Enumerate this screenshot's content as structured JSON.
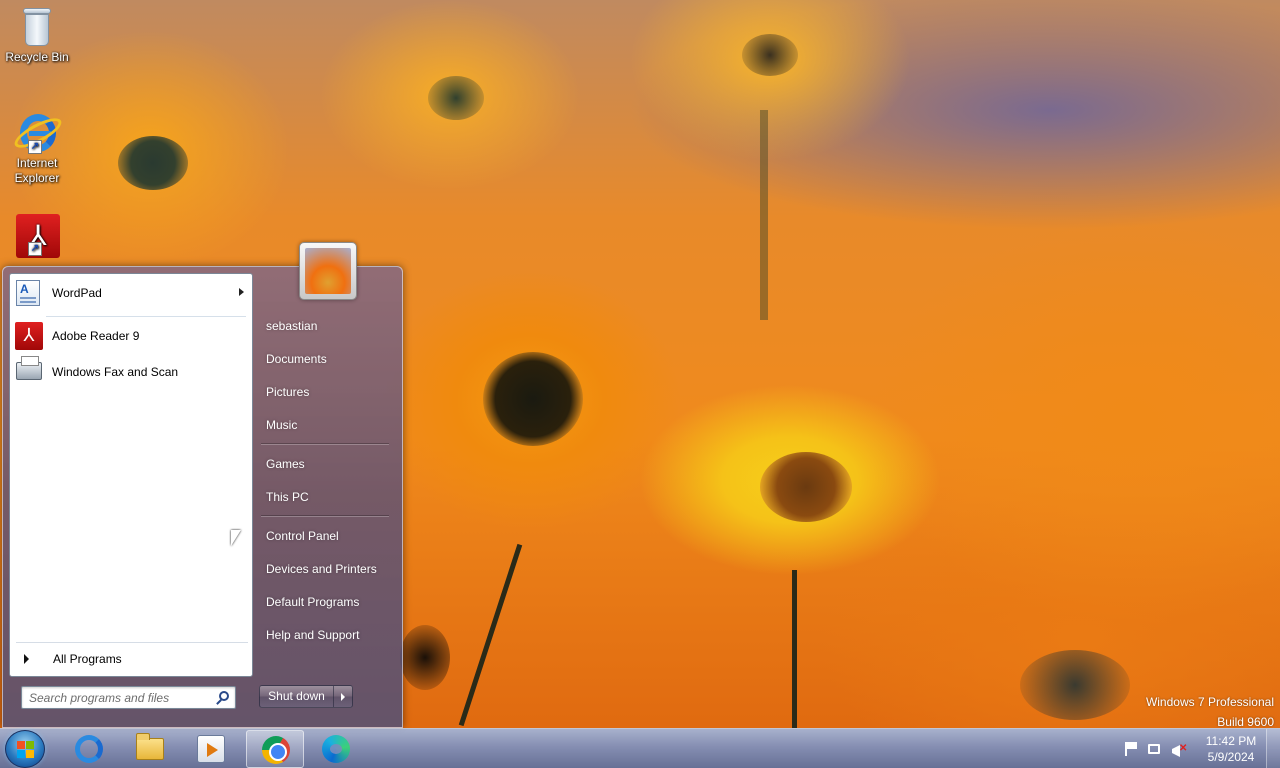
{
  "desktop": {
    "icons": [
      {
        "label": "Recycle Bin"
      },
      {
        "label": "Internet Explorer"
      },
      {
        "label": "Adobe Reader 9"
      }
    ],
    "watermark": {
      "line1": "Windows 7 Professional",
      "line2": "Build 9600"
    }
  },
  "start_menu": {
    "pinned": [
      {
        "label": "WordPad",
        "icon": "wordpad-icon",
        "has_submenu": true
      },
      {
        "label": "Adobe Reader 9",
        "icon": "adobe-reader-icon"
      },
      {
        "label": "Windows Fax and Scan",
        "icon": "fax-scanner-icon"
      }
    ],
    "all_programs": "All Programs",
    "search_placeholder": "Search programs and files",
    "user_name": "sebastian",
    "right_links": {
      "documents": "Documents",
      "pictures": "Pictures",
      "music": "Music",
      "games": "Games",
      "this_pc": "This PC",
      "control_panel": "Control Panel",
      "devices_printers": "Devices and Printers",
      "default_programs": "Default Programs",
      "help_support": "Help and Support"
    },
    "shutdown_label": "Shut down"
  },
  "taskbar": {
    "apps": [
      "internet-explorer-icon",
      "file-explorer-icon",
      "media-player-icon",
      "chrome-icon",
      "edge-icon"
    ],
    "active_app": "chrome-icon",
    "tray": [
      "action-center-flag-icon",
      "network-icon",
      "volume-muted-icon"
    ],
    "clock": {
      "time": "11:42 PM",
      "date": "5/9/2024"
    }
  }
}
